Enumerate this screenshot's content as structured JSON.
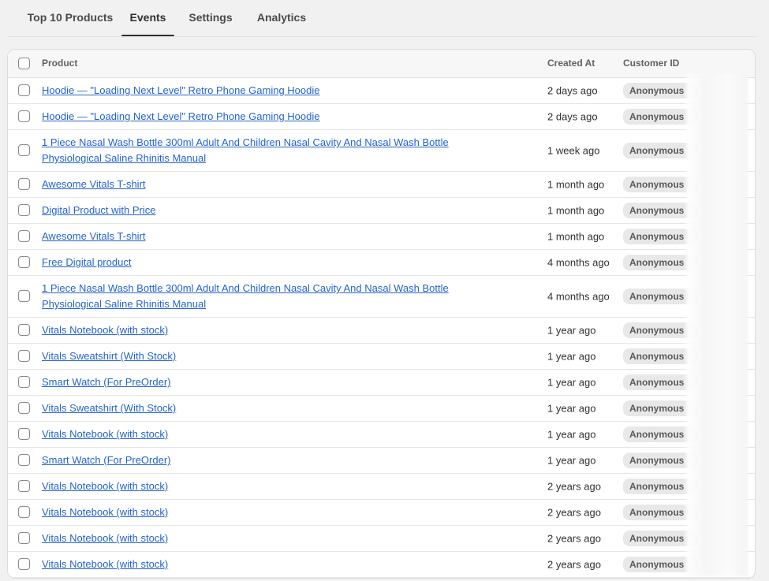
{
  "tabs": [
    {
      "label": "Top 10 Products",
      "active": false
    },
    {
      "label": "Events",
      "active": true
    },
    {
      "label": "Settings",
      "active": false
    },
    {
      "label": "Analytics",
      "active": false
    }
  ],
  "table": {
    "columns": {
      "product": "Product",
      "created_at": "Created At",
      "customer_id": "Customer ID"
    },
    "rows": [
      {
        "product": "Hoodie — \"Loading Next Level\" Retro Phone Gaming Hoodie",
        "created": "2 days ago",
        "customer": "Anonymous"
      },
      {
        "product": "Hoodie — \"Loading Next Level\" Retro Phone Gaming Hoodie",
        "created": "2 days ago",
        "customer": "Anonymous"
      },
      {
        "product": "1 Piece Nasal Wash Bottle 300ml Adult And Children Nasal Cavity And Nasal Wash Bottle Physiological Saline Rhinitis Manual",
        "created": "1 week ago",
        "customer": "Anonymous"
      },
      {
        "product": "Awesome Vitals T-shirt",
        "created": "1 month ago",
        "customer": "Anonymous"
      },
      {
        "product": "Digital Product with Price",
        "created": "1 month ago",
        "customer": "Anonymous"
      },
      {
        "product": "Awesome Vitals T-shirt",
        "created": "1 month ago",
        "customer": "Anonymous"
      },
      {
        "product": "Free Digital product",
        "created": "4 months ago",
        "customer": "Anonymous"
      },
      {
        "product": "1 Piece Nasal Wash Bottle 300ml Adult And Children Nasal Cavity And Nasal Wash Bottle Physiological Saline Rhinitis Manual",
        "created": "4 months ago",
        "customer": "Anonymous"
      },
      {
        "product": "Vitals Notebook (with stock)",
        "created": "1 year ago",
        "customer": "Anonymous"
      },
      {
        "product": "Vitals Sweatshirt (With Stock)",
        "created": "1 year ago",
        "customer": "Anonymous"
      },
      {
        "product": "Smart Watch (For PreOrder)",
        "created": "1 year ago",
        "customer": "Anonymous"
      },
      {
        "product": "Vitals Sweatshirt (With Stock)",
        "created": "1 year ago",
        "customer": "Anonymous"
      },
      {
        "product": "Vitals Notebook (with stock)",
        "created": "1 year ago",
        "customer": "Anonymous"
      },
      {
        "product": "Smart Watch (For PreOrder)",
        "created": "1 year ago",
        "customer": "Anonymous"
      },
      {
        "product": "Vitals Notebook (with stock)",
        "created": "2 years ago",
        "customer": "Anonymous"
      },
      {
        "product": "Vitals Notebook (with stock)",
        "created": "2 years ago",
        "customer": "Anonymous"
      },
      {
        "product": "Vitals Notebook (with stock)",
        "created": "2 years ago",
        "customer": "Anonymous"
      },
      {
        "product": "Vitals Notebook (with stock)",
        "created": "2 years ago",
        "customer": "Anonymous"
      }
    ]
  },
  "colors": {
    "link": "#2463d1",
    "badge_bg": "#e8e8e8",
    "page_bg": "#f1f1f1"
  }
}
